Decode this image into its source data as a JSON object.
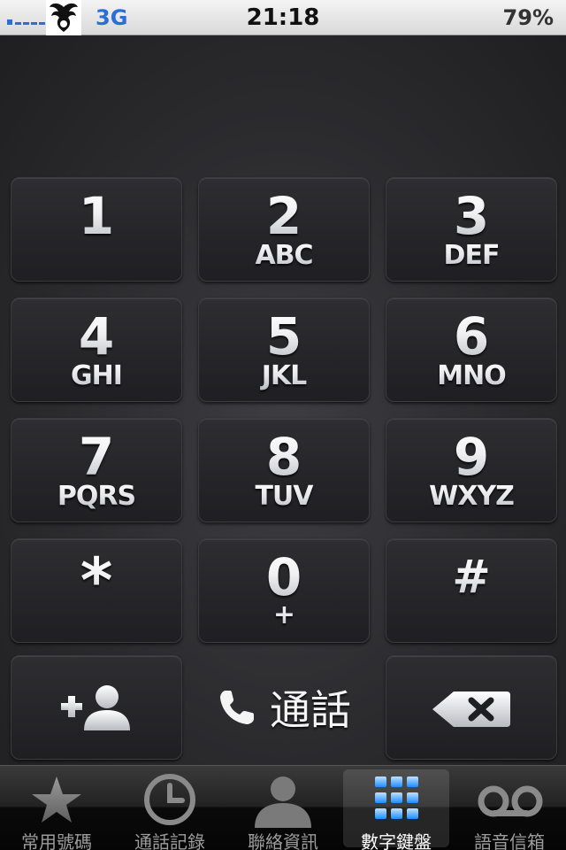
{
  "status_bar": {
    "network": "3G",
    "time": "21:18",
    "battery": "79%"
  },
  "keypad": {
    "keys": [
      {
        "digit": "1",
        "letters": ""
      },
      {
        "digit": "2",
        "letters": "ABC"
      },
      {
        "digit": "3",
        "letters": "DEF"
      },
      {
        "digit": "4",
        "letters": "GHI"
      },
      {
        "digit": "5",
        "letters": "JKL"
      },
      {
        "digit": "6",
        "letters": "MNO"
      },
      {
        "digit": "7",
        "letters": "PQRS"
      },
      {
        "digit": "8",
        "letters": "TUV"
      },
      {
        "digit": "9",
        "letters": "WXYZ"
      },
      {
        "digit": "*",
        "letters": ""
      },
      {
        "digit": "0",
        "letters": "+"
      },
      {
        "digit": "#",
        "letters": ""
      }
    ],
    "call_label": "通話"
  },
  "icons": {
    "add_contact": "add-contact-icon",
    "call": "phone-icon",
    "delete": "backspace-icon"
  },
  "tab_bar": {
    "tabs": [
      {
        "label": "常用號碼",
        "icon": "star-icon",
        "active": false
      },
      {
        "label": "通話記錄",
        "icon": "clock-icon",
        "active": false
      },
      {
        "label": "聯絡資訊",
        "icon": "contact-icon",
        "active": false
      },
      {
        "label": "數字鍵盤",
        "icon": "keypad-icon",
        "active": true
      },
      {
        "label": "語音信箱",
        "icon": "voicemail-icon",
        "active": false
      }
    ]
  },
  "colors": {
    "accent_blue": "#2a6fd6",
    "active_tab_icon": "#3aa0ff"
  }
}
